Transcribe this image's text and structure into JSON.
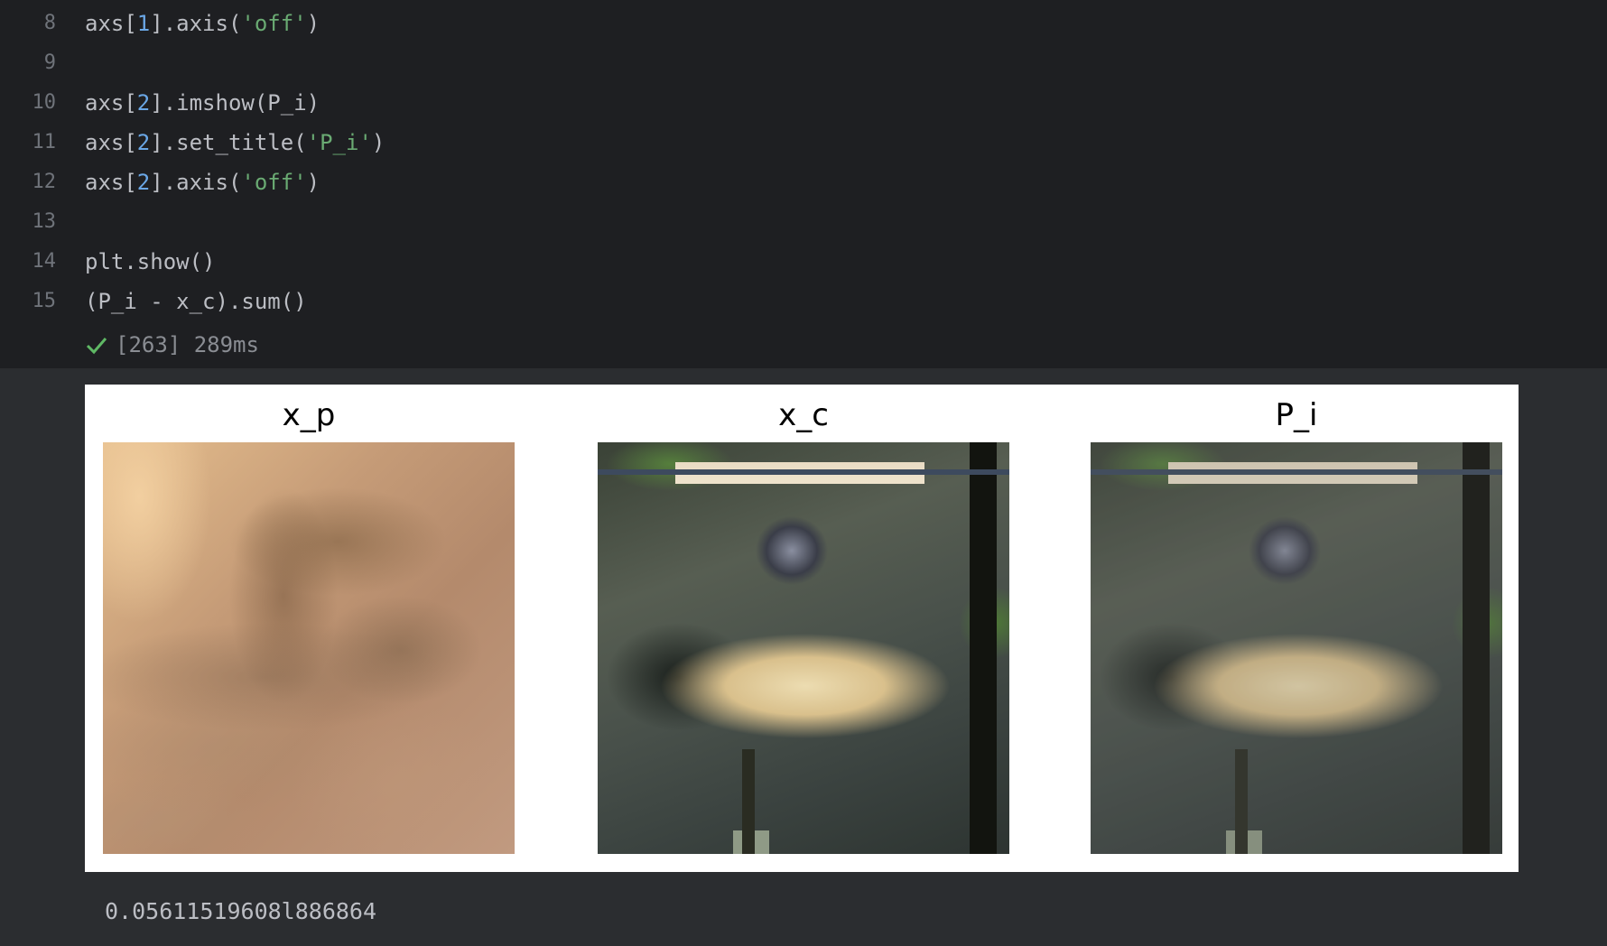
{
  "editor": {
    "lines": [
      {
        "number": "8",
        "parts": [
          {
            "t": "axs[",
            "c": ""
          },
          {
            "t": "1",
            "c": "num"
          },
          {
            "t": "].axis(",
            "c": ""
          },
          {
            "t": "'off'",
            "c": "str"
          },
          {
            "t": ")",
            "c": ""
          }
        ]
      },
      {
        "number": "9",
        "parts": []
      },
      {
        "number": "10",
        "parts": [
          {
            "t": "axs[",
            "c": ""
          },
          {
            "t": "2",
            "c": "num"
          },
          {
            "t": "].imshow(P_i)",
            "c": ""
          }
        ]
      },
      {
        "number": "11",
        "parts": [
          {
            "t": "axs[",
            "c": ""
          },
          {
            "t": "2",
            "c": "num"
          },
          {
            "t": "].set_title(",
            "c": ""
          },
          {
            "t": "'P_i'",
            "c": "str"
          },
          {
            "t": ")",
            "c": ""
          }
        ]
      },
      {
        "number": "12",
        "parts": [
          {
            "t": "axs[",
            "c": ""
          },
          {
            "t": "2",
            "c": "num"
          },
          {
            "t": "].axis(",
            "c": ""
          },
          {
            "t": "'off'",
            "c": "str"
          },
          {
            "t": ")",
            "c": ""
          }
        ]
      },
      {
        "number": "13",
        "parts": []
      },
      {
        "number": "14",
        "parts": [
          {
            "t": "plt.show()",
            "c": ""
          }
        ]
      },
      {
        "number": "15",
        "parts": [
          {
            "t": "(P_i - x_c).sum()",
            "c": ""
          }
        ]
      }
    ]
  },
  "run_status": {
    "icon": "check-icon",
    "text": "[263] 289ms",
    "color": "#5fb865"
  },
  "figure": {
    "panels": [
      {
        "title": "x_p"
      },
      {
        "title": "x_c"
      },
      {
        "title": "P_i"
      }
    ]
  },
  "output": {
    "result": "0.05611519608l886864"
  },
  "colors": {
    "editor_bg": "#1e1f22",
    "output_bg": "#2b2d30",
    "text": "#bcbec4",
    "number": "#6aa7e6",
    "string": "#6aab73",
    "gutter": "#6f737a"
  }
}
